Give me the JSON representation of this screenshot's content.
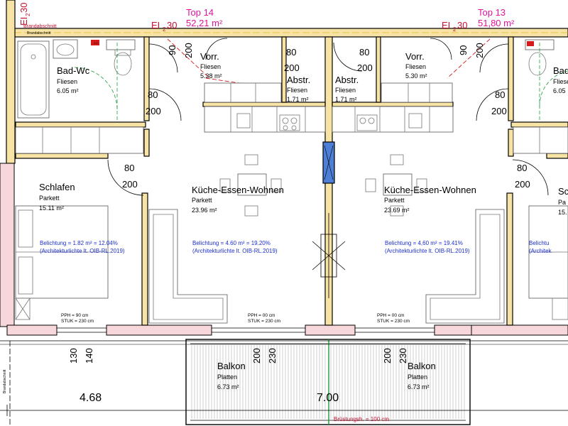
{
  "units": [
    {
      "name": "Top 14",
      "area": "52,21 m²",
      "fire": "EI",
      "fire_sub": "2",
      "fire_val": "30"
    },
    {
      "name": "Top 13",
      "area": "51,80 m²",
      "fire": "EI",
      "fire_sub": "2",
      "fire_val": "30"
    }
  ],
  "left_fire": {
    "prefix": "EI",
    "sub": "2",
    "val": "30"
  },
  "brandabschnitt": "Brandabschnitt",
  "rooms": {
    "bad_left": {
      "name": "Bad-Wc",
      "floor": "Fliesen",
      "area": "6.05 m²"
    },
    "bad_right": {
      "name": "Bad-",
      "floor": "Fliesen",
      "area": "6.05"
    },
    "vorr_left": {
      "name": "Vorr.",
      "floor": "Fliesen",
      "area": "5.38 m²"
    },
    "vorr_right": {
      "name": "Vorr.",
      "floor": "Fliesen",
      "area": "5.30 m²"
    },
    "abstr_left": {
      "name": "Abstr.",
      "floor": "Fliesen",
      "area": "1.71 m²"
    },
    "abstr_right": {
      "name": "Abstr.",
      "floor": "Fliesen",
      "area": "1.71 m²"
    },
    "schlafen_left": {
      "name": "Schlafen",
      "floor": "Parkett",
      "area": "15.11 m²"
    },
    "schlafen_right": {
      "name": "Sc",
      "floor": "Pa",
      "area": "15."
    },
    "kew_left": {
      "name": "Küche-Essen-Wohnen",
      "floor": "Parkett",
      "area": "23.96 m²"
    },
    "kew_right": {
      "name": "Küche-Essen-Wohnen",
      "floor": "Parkett",
      "area": "23.69 m²"
    },
    "balkon_left": {
      "name": "Balkon",
      "floor": "Platten",
      "area": "6.73 m²"
    },
    "balkon_right": {
      "name": "Balkon",
      "floor": "Platten",
      "area": "6.73 m²"
    }
  },
  "belichtung": {
    "schlafen_left": {
      "line1": "Belichtung = 1.82 m² = 12.04%",
      "line2": "(Architekturlichte lt. OIB-RL.2019)"
    },
    "kew_left": {
      "line1": "Belichtung = 4.60 m² = 19.20%",
      "line2": "(Architekturlichte lt. OIB-RL.2019)"
    },
    "kew_right": {
      "line1": "Belichtung = 4,60 m² = 19.41%",
      "line2": "(Architekturlichte lt. OIB-RL.2019)"
    },
    "schlafen_right": {
      "line1": "Belichtu",
      "line2": "(Architek"
    }
  },
  "pph": [
    {
      "pph": "PPH   = 90 cm",
      "stuk": "STUK = 230 cm"
    },
    {
      "pph": "PPH   = 00 cm",
      "stuk": "STUK = 230 cm"
    },
    {
      "pph": "PPH   = 00 cm",
      "stuk": "STUK = 230 cm"
    }
  ],
  "door_dims": {
    "d80": "80",
    "d200": "200",
    "d90": "90"
  },
  "dims": {
    "d130": "130",
    "d140": "140",
    "d200": "200",
    "d230": "230",
    "w468": "4.68",
    "w700": "7.00"
  },
  "bruestung": "Brüstungsh. = 100 cm",
  "colors": {
    "magenta": "#e0139c",
    "red": "#c8102e",
    "blue": "#1b2fd0",
    "wall": "#f7e3a4",
    "firewall": "#f8d7da",
    "column": "#4d7fd6"
  }
}
